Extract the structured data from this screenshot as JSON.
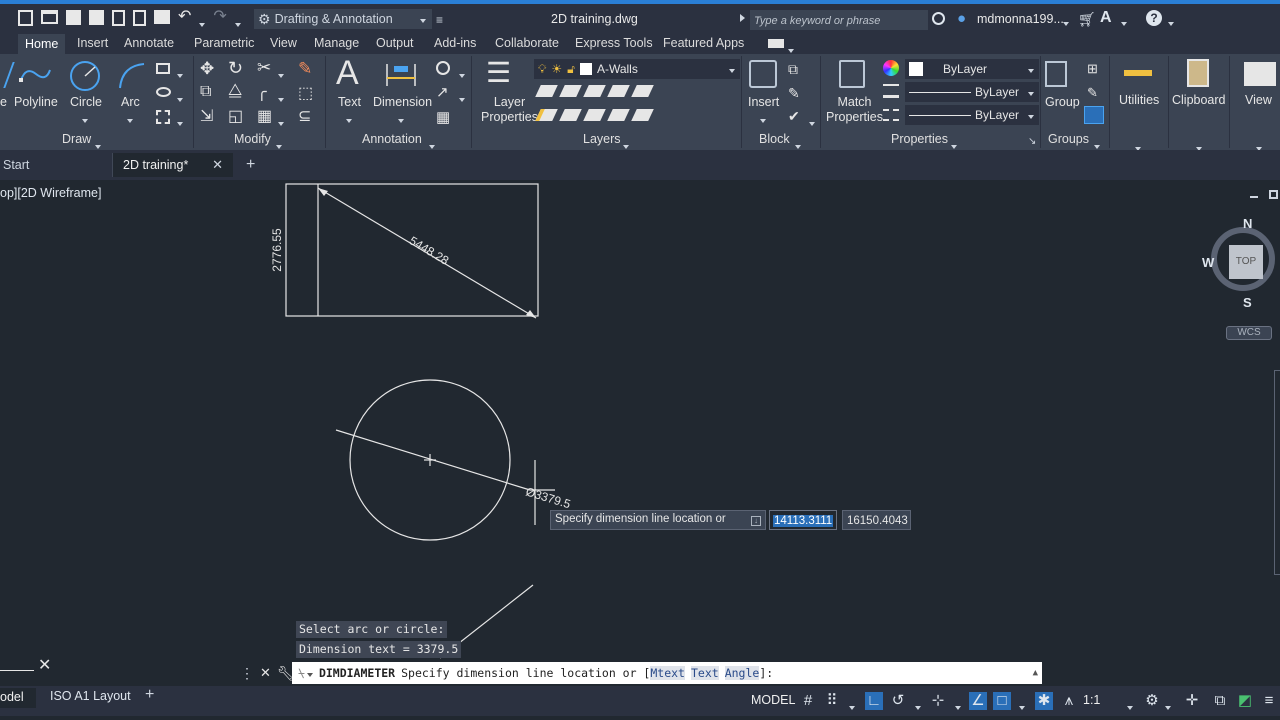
{
  "title": {
    "workspace": "Drafting & Annotation",
    "filename": "2D training.dwg",
    "search_placeholder": "Type a keyword or phrase",
    "user": "mdmonna199..."
  },
  "ribbon_tabs": [
    "Home",
    "Insert",
    "Annotate",
    "Parametric",
    "View",
    "Manage",
    "Output",
    "Add-ins",
    "Collaborate",
    "Express Tools",
    "Featured Apps"
  ],
  "draw": {
    "polyline": "Polyline",
    "circle": "Circle",
    "arc": "Arc",
    "title": "Draw"
  },
  "modify": {
    "title": "Modify"
  },
  "annotation": {
    "text": "Text",
    "dimension": "Dimension",
    "title": "Annotation"
  },
  "layers": {
    "layer_properties": "Layer\nProperties",
    "layer_properties_l1": "Layer",
    "layer_properties_l2": "Properties",
    "current_layer": "A-Walls",
    "title": "Layers"
  },
  "block": {
    "insert": "Insert",
    "title": "Block"
  },
  "properties": {
    "match_l1": "Match",
    "match_l2": "Properties",
    "color": "ByLayer",
    "linetype": "ByLayer",
    "lineweight": "ByLayer",
    "title": "Properties"
  },
  "groups": {
    "group": "Group",
    "title": "Groups"
  },
  "utilities": "Utilities",
  "clipboard": "Clipboard",
  "view": "View",
  "doc_tabs": {
    "start": "Start",
    "active": "2D training*"
  },
  "viewport_label": "op][2D Wireframe]",
  "viewcube": {
    "n": "N",
    "s": "S",
    "w": "W",
    "top": "TOP",
    "wcs": "WCS"
  },
  "drawing": {
    "vertical_dim": "2776.55",
    "diagonal_dim": "5448.28",
    "diameter_dim": "Ø3379.5"
  },
  "tooltip": {
    "prompt": "Specify dimension line location or",
    "x_value": "14113.3111",
    "y_value": "16150.4043"
  },
  "history": {
    "line1": "Select arc or circle:",
    "line2": "Dimension text = 3379.5"
  },
  "command_line": {
    "command": "DIMDIAMETER",
    "text": "Specify dimension line location or [",
    "opt1": "Mtext",
    "opt2": "Text",
    "opt3": "Angle",
    "end": "]:"
  },
  "layout_tabs": {
    "model": "odel",
    "layout1": "ISO A1 Layout"
  },
  "status": {
    "model": "MODEL",
    "scale": "1:1"
  },
  "colors": {
    "accent": "#2a7fd6",
    "bg": "#212830",
    "ribbon": "#3b4453",
    "highlight": "#2a6fb8"
  }
}
